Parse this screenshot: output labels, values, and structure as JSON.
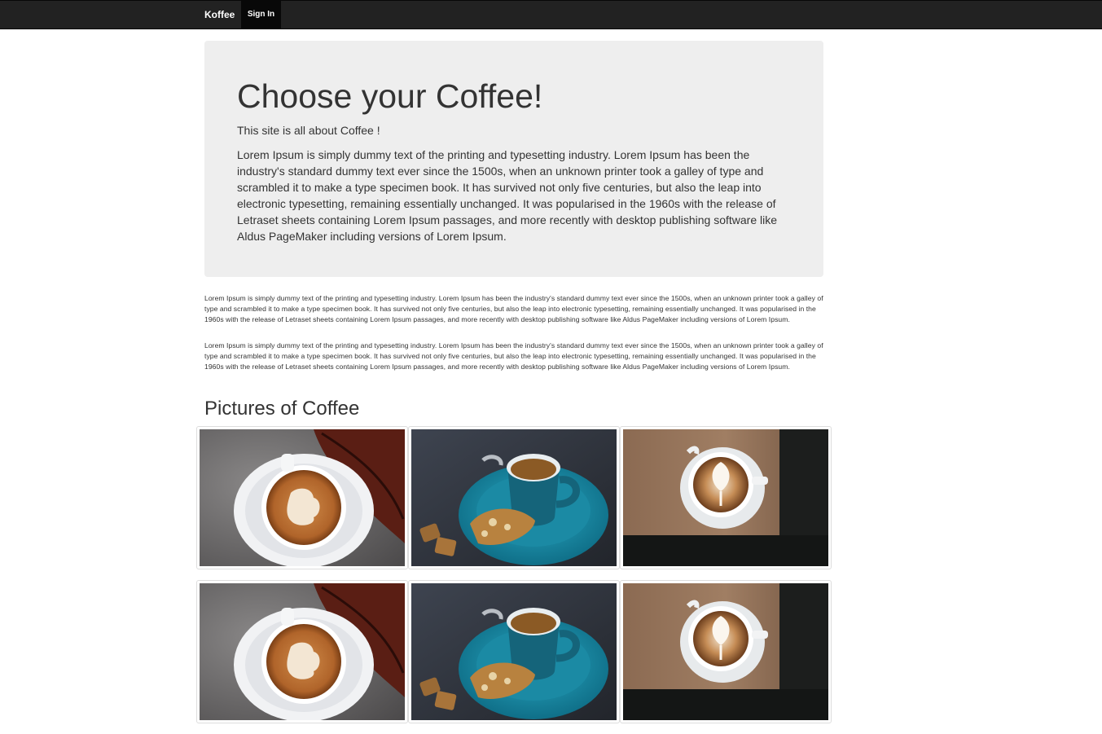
{
  "navbar": {
    "brand": "Koffee",
    "signin_label": "Sign In"
  },
  "jumbotron": {
    "title": "Choose your Coffee!",
    "lead": "This site is all about Coffee !",
    "description": "Lorem Ipsum is simply dummy text of the printing and typesetting industry. Lorem Ipsum has been the industry's standard dummy text ever since the 1500s, when an unknown printer took a galley of type and scrambled it to make a type specimen book. It has survived not only five centuries, but also the leap into electronic typesetting, remaining essentially unchanged. It was popularised in the 1960s with the release of Letraset sheets containing Lorem Ipsum passages, and more recently with desktop publishing software like Aldus PageMaker including versions of Lorem Ipsum."
  },
  "paragraphs": [
    "Lorem Ipsum is simply dummy text of the printing and typesetting industry. Lorem Ipsum has been the industry's standard dummy text ever since the 1500s, when an unknown printer took a galley of type and scrambled it to make a type specimen book. It has survived not only five centuries, but also the leap into electronic typesetting, remaining essentially unchanged. It was popularised in the 1960s with the release of Letraset sheets containing Lorem Ipsum passages, and more recently with desktop publishing software like Aldus PageMaker including versions of Lorem Ipsum.",
    "Lorem Ipsum is simply dummy text of the printing and typesetting industry. Lorem Ipsum has been the industry's standard dummy text ever since the 1500s, when an unknown printer took a galley of type and scrambled it to make a type specimen book. It has survived not only five centuries, but also the leap into electronic typesetting, remaining essentially unchanged. It was popularised in the 1960s with the release of Letraset sheets containing Lorem Ipsum passages, and more recently with desktop publishing software like Aldus PageMaker including versions of Lorem Ipsum."
  ],
  "gallery": {
    "title": "Pictures of Coffee",
    "images": [
      {
        "name": "latte-with-autumn-leaf-photo"
      },
      {
        "name": "espresso-with-biscotti-photo"
      },
      {
        "name": "cappuccino-on-wood-table-photo"
      },
      {
        "name": "latte-with-autumn-leaf-photo"
      },
      {
        "name": "espresso-with-biscotti-photo"
      },
      {
        "name": "cappuccino-on-wood-table-photo"
      }
    ]
  },
  "colors": {
    "navbar_bg": "#222222",
    "jumbotron_bg": "#eeeeee",
    "text": "#333333"
  }
}
